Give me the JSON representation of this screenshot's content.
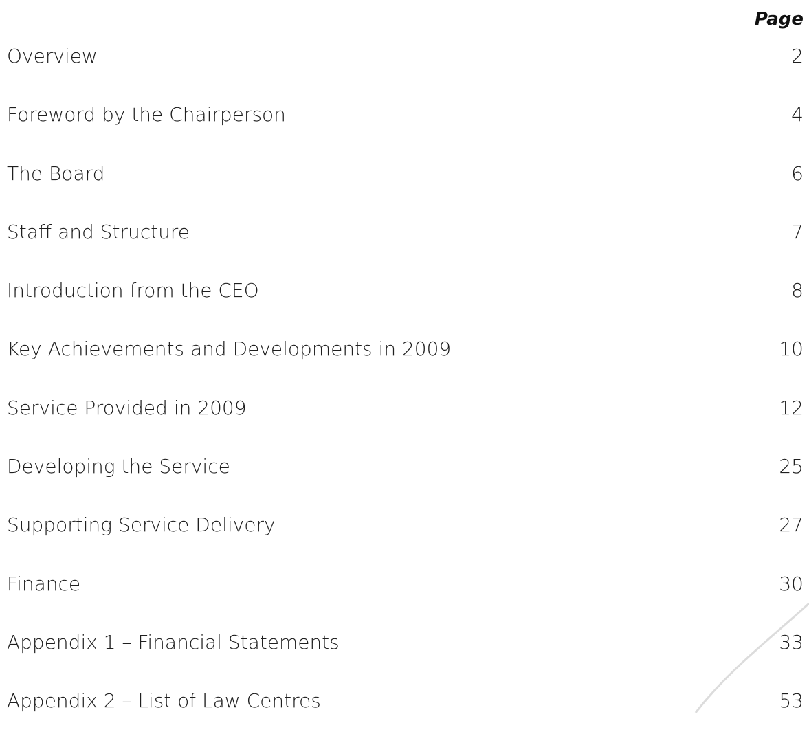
{
  "header": {
    "page_label": "Page"
  },
  "toc": {
    "entries": [
      {
        "title": "Overview",
        "page": "2"
      },
      {
        "title": "Foreword by the Chairperson",
        "page": "4"
      },
      {
        "title": "The Board",
        "page": "6"
      },
      {
        "title": "Staff and Structure",
        "page": "7"
      },
      {
        "title": "Introduction from the CEO",
        "page": "8"
      },
      {
        "title": "Key Achievements and Developments in 2009",
        "page": "10"
      },
      {
        "title": "Service Provided in 2009",
        "page": "12"
      },
      {
        "title": "Developing the Service",
        "page": "25"
      },
      {
        "title": "Supporting Service Delivery",
        "page": "27"
      },
      {
        "title": "Finance",
        "page": "30"
      },
      {
        "title": "Appendix 1 – Financial Statements",
        "page": "33"
      },
      {
        "title": "Appendix 2 – List of Law Centres",
        "page": "53"
      }
    ]
  },
  "colors": {
    "text": "#1f1f1f",
    "swoosh": "#dcdcdc"
  }
}
